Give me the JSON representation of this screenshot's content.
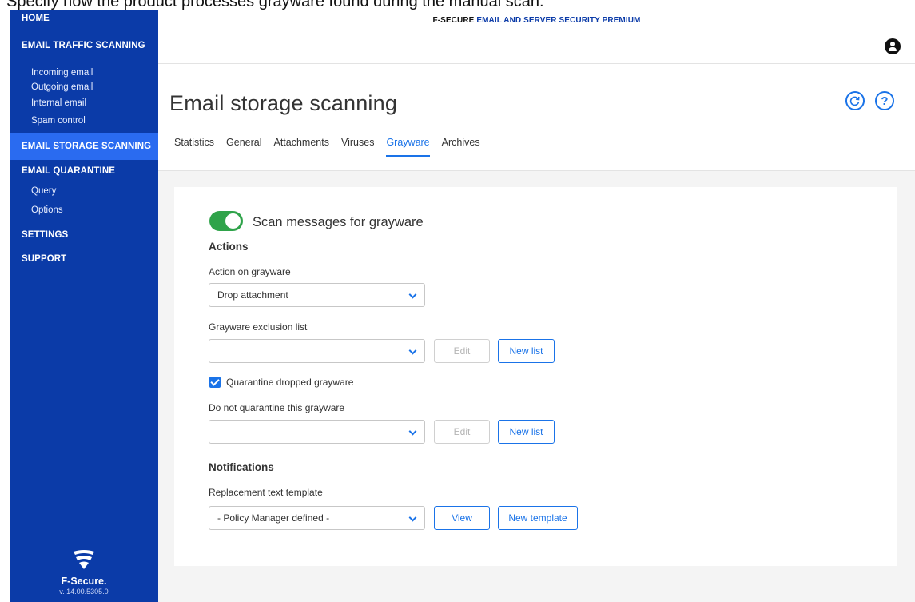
{
  "caption": "Specify how the product processes grayware found during the manual scan.",
  "sidebar": {
    "items": [
      {
        "label": "HOME",
        "kind": "section"
      },
      {
        "label": "EMAIL TRAFFIC SCANNING",
        "kind": "section"
      },
      {
        "label": "Incoming email",
        "kind": "sub"
      },
      {
        "label": "Outgoing email",
        "kind": "sub"
      },
      {
        "label": "Internal email",
        "kind": "sub"
      },
      {
        "label": "Spam control",
        "kind": "sub"
      },
      {
        "label": "EMAIL STORAGE SCANNING",
        "kind": "section",
        "active": true
      },
      {
        "label": "EMAIL QUARANTINE",
        "kind": "section"
      },
      {
        "label": "Query",
        "kind": "sub"
      },
      {
        "label": "Options",
        "kind": "sub"
      },
      {
        "label": "SETTINGS",
        "kind": "section"
      },
      {
        "label": "SUPPORT",
        "kind": "section"
      }
    ],
    "brand": {
      "name": "F-Secure.",
      "version": "v. 14.00.5305.0",
      "icon": "f-secure-logo-icon"
    }
  },
  "header": {
    "product_prefix": "F-SECURE",
    "product_name": "EMAIL AND SERVER SECURITY PREMIUM",
    "user_icon": "user-account-icon"
  },
  "page": {
    "title": "Email storage scanning",
    "refresh_icon": "refresh-icon",
    "help_icon": "help-icon",
    "tabs": [
      "Statistics",
      "General",
      "Attachments",
      "Viruses",
      "Grayware",
      "Archives"
    ],
    "active_tab": "Grayware"
  },
  "form": {
    "scan_toggle": {
      "label": "Scan messages for grayware",
      "on": true
    },
    "actions_title": "Actions",
    "action_on_grayware": {
      "label": "Action on grayware",
      "value": "Drop attachment"
    },
    "exclusion_list": {
      "label": "Grayware exclusion list",
      "value": "",
      "edit_label": "Edit",
      "new_label": "New list"
    },
    "quarantine_checkbox": {
      "label": "Quarantine dropped grayware",
      "checked": true
    },
    "no_quarantine": {
      "label": "Do not quarantine this grayware",
      "value": "",
      "edit_label": "Edit",
      "new_label": "New list"
    },
    "notifications_title": "Notifications",
    "replacement_template": {
      "label": "Replacement text template",
      "value": "- Policy Manager defined -",
      "view_label": "View",
      "new_label": "New template"
    }
  },
  "colors": {
    "sidebar": "#0b3ba8",
    "sidebar_active": "#2a6bf0",
    "accent": "#1a73e8",
    "toggle_on": "#2fa34a"
  }
}
